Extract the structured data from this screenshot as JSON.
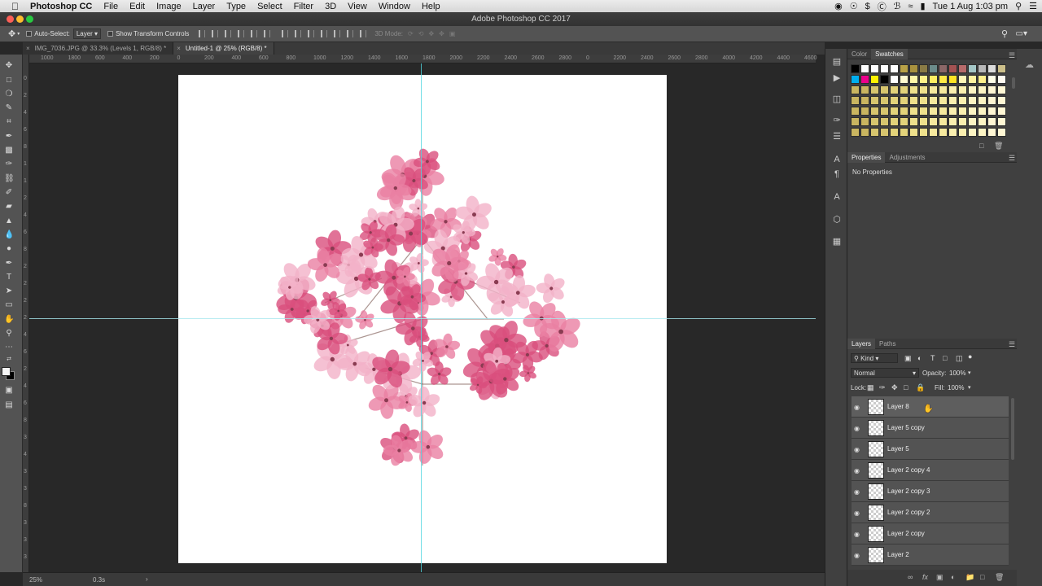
{
  "menubar": {
    "apple": "",
    "app_name": "Photoshop CC",
    "items": [
      "File",
      "Edit",
      "Image",
      "Layer",
      "Type",
      "Select",
      "Filter",
      "3D",
      "View",
      "Window",
      "Help"
    ],
    "clock": "Tue 1 Aug  1:03 pm"
  },
  "window": {
    "title": "Adobe Photoshop CC 2017"
  },
  "options": {
    "auto_select_label": "Auto-Select:",
    "auto_select_value": "Layer",
    "show_transform_label": "Show Transform Controls",
    "mode_3d_label": "3D Mode:"
  },
  "tabs": [
    {
      "label": "IMG_7036.JPG @ 33.3% (Levels 1, RGB/8) *",
      "active": false
    },
    {
      "label": "Untitled-1 @ 25% (RGB/8) *",
      "active": true
    }
  ],
  "ruler": {
    "h_ticks": [
      "1000",
      "1800",
      "600",
      "400",
      "200",
      "0",
      "200",
      "400",
      "600",
      "800",
      "1000",
      "1200",
      "1400",
      "1600",
      "1800",
      "2000",
      "2200",
      "2400",
      "2600",
      "2800",
      "0",
      "2200",
      "2400",
      "2600",
      "2800",
      "4000",
      "4200",
      "4400",
      "4600"
    ],
    "v_ticks": [
      "0",
      "2",
      "4",
      "6",
      "8",
      "1",
      "1",
      "2",
      "4",
      "6",
      "8",
      "2",
      "2",
      "2",
      "2",
      "4",
      "6",
      "2",
      "4",
      "6",
      "8",
      "3",
      "4",
      "3",
      "3",
      "8",
      "3",
      "3",
      "3"
    ]
  },
  "status": {
    "zoom": "25%",
    "timing": "0.3s"
  },
  "color_panel": {
    "tabs": [
      {
        "label": "Color",
        "active": false
      },
      {
        "label": "Swatches",
        "active": true
      }
    ],
    "row1": [
      "#000000",
      "#ffffff",
      "#ffffff",
      "#ffffff",
      "#ffffff",
      "#b9a247",
      "#a8913e",
      "#8a7b45",
      "#6b8b8a",
      "#8b6767",
      "#a45252",
      "#b86b6b",
      "#a5c7c7",
      "#b8b8b8",
      "#dcdcdc",
      "#ccbf8a"
    ],
    "row2": [
      "#00aeef",
      "#ec008c",
      "#fff200",
      "#000000",
      "#ffffff",
      "#fffbd0",
      "#fff7a8",
      "#fff28a",
      "#ffee62",
      "#ffe946",
      "#ffe425",
      "#fff7b8",
      "#fff3a0",
      "#fff08c",
      "#ffffe8",
      "#fffaf0"
    ],
    "grid_colors": [
      "#c9b560",
      "#d7c56e",
      "#e3d37a",
      "#efe18c",
      "#f6e99e",
      "#fbf0b0",
      "#fdf5c4",
      "#fff7d4"
    ]
  },
  "properties_panel": {
    "tabs": [
      {
        "label": "Properties",
        "active": true
      },
      {
        "label": "Adjustments",
        "active": false
      }
    ],
    "message": "No Properties"
  },
  "layers_panel": {
    "tabs": [
      {
        "label": "Layers",
        "active": true
      },
      {
        "label": "Paths",
        "active": false
      }
    ],
    "filter_label": "Kind",
    "blend_mode": "Normal",
    "opacity_label": "Opacity:",
    "opacity_value": "100%",
    "lock_label": "Lock:",
    "fill_label": "Fill:",
    "fill_value": "100%",
    "layers": [
      {
        "name": "Layer 8",
        "selected": true
      },
      {
        "name": "Layer 5 copy",
        "selected": false
      },
      {
        "name": "Layer 5",
        "selected": false
      },
      {
        "name": "Layer 2 copy 4",
        "selected": false
      },
      {
        "name": "Layer 2 copy 3",
        "selected": false
      },
      {
        "name": "Layer 2 copy 2",
        "selected": false
      },
      {
        "name": "Layer 2 copy",
        "selected": false
      },
      {
        "name": "Layer 2",
        "selected": false
      }
    ]
  },
  "colors": {
    "flower_dark": "#d94f7d",
    "flower_mid": "#ea7fa2",
    "flower_light": "#f3b2c8",
    "branch": "#8a6a64"
  }
}
